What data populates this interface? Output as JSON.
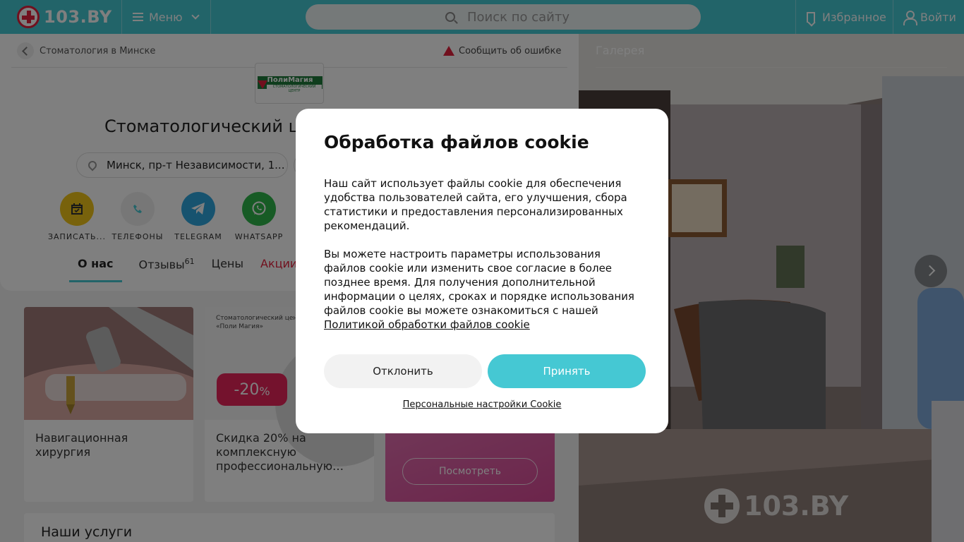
{
  "header": {
    "logo_text": "103.BY",
    "menu_label": "Меню",
    "search_placeholder": "Поиск по сайту",
    "favorites_label": "Избранное",
    "login_label": "Войти"
  },
  "breadcrumb": {
    "back_label": "Стоматология в Минске",
    "report_label": "Сообщить об ошибке"
  },
  "clinic": {
    "logo_name": "ПолиМагия",
    "logo_sub": "СТОМАТОЛОГИЧЕСКИЙ ЦЕНТР",
    "title": "Стоматологический ц",
    "address": "Минск, пр-т Независимости, 1...",
    "actions": [
      {
        "label": "ЗАПИСАТЬ...",
        "icon": "calendar-icon"
      },
      {
        "label": "ТЕЛЕФОНЫ",
        "icon": "phone-icon"
      },
      {
        "label": "TELEGRAM",
        "icon": "telegram-icon"
      },
      {
        "label": "WHATSAPP",
        "icon": "whatsapp-icon"
      }
    ],
    "tabs": [
      {
        "label": "О нас",
        "count": ""
      },
      {
        "label": "Отзывы",
        "count": "61"
      },
      {
        "label": "Цены",
        "count": ""
      },
      {
        "label": "Акции и",
        "count": ""
      }
    ]
  },
  "promos": [
    {
      "title": "Навигационная хирургия"
    },
    {
      "title": "Скидка 20% на комплексную профессиональную…",
      "img_caption_line1": "Стоматологический цент",
      "img_caption_line2": "«Поли Магия»",
      "badge_main": "-20",
      "badge_suffix": "%"
    },
    {
      "button": "Посмотреть"
    }
  ],
  "services_title": "Наши услуги",
  "gallery": {
    "title": "Галерея",
    "watermark": "103.BY"
  },
  "cookie_modal": {
    "title": "Обработка файлов cookie",
    "paragraph1": "Наш сайт использует файлы cookie для обеспечения удобства пользователей сайта, его улучшения, сбора статистики и предоставления персонализированных рекомендаций.",
    "paragraph2": "Вы можете настроить параметры использования файлов cookie или изменить свое согласие в более позднее время. Для получения дополнительной информации о целях, сроках и порядке использования файлов cookie вы можете ознакомиться с нашей",
    "policy_link": "Политикой обработки файлов cookie",
    "decline_label": "Отклонить",
    "accept_label": "Принять",
    "settings_link": "Персональные настройки Cookie"
  },
  "colors": {
    "brand": "#45c8d3",
    "accent_red": "#e2203c",
    "telegram": "#2ea6df",
    "whatsapp": "#2fb64a",
    "booking": "#f0c419",
    "promo_pink": "#d94a97"
  }
}
